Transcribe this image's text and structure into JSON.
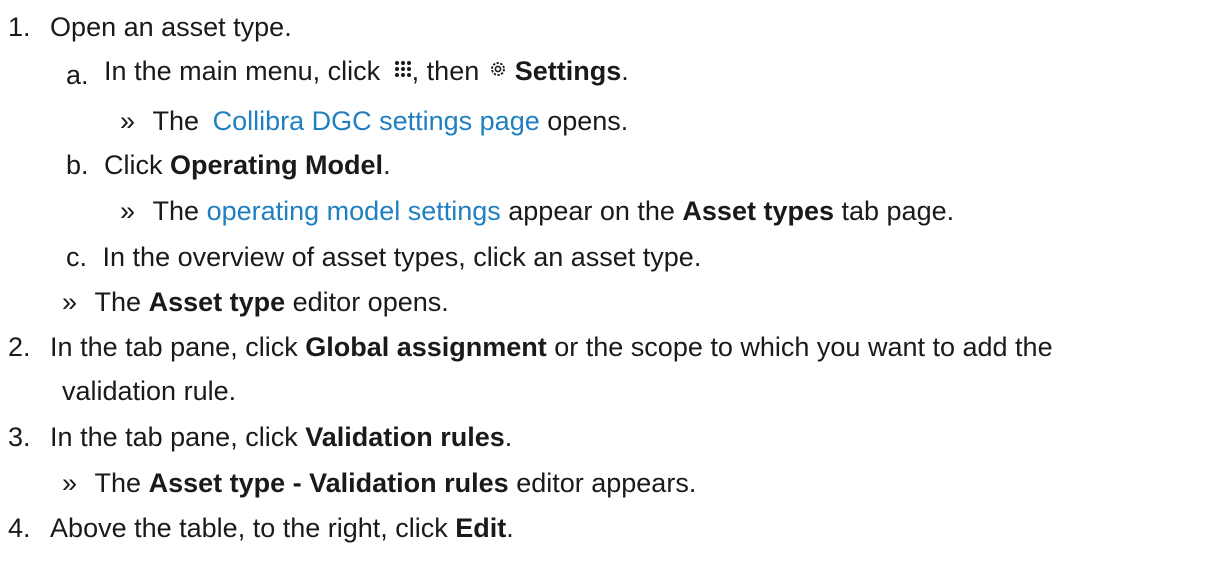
{
  "steps": [
    {
      "number": "1.",
      "text": "Open an asset type.",
      "substeps": [
        {
          "letter": "a.",
          "t1": "In the main menu, click ",
          "t2": ", then ",
          "settings_label": "Settings",
          "t3": ".",
          "result": {
            "arrow": "»",
            "t1": "The ",
            "link": "Collibra DGC settings page",
            "t2": " opens."
          }
        },
        {
          "letter": "b.",
          "t1": "Click ",
          "bold": "Operating Model",
          "t2": ".",
          "result": {
            "arrow": "»",
            "t1": "The ",
            "link": "operating model settings",
            "t2": " appear on the ",
            "bold": "Asset types",
            "t3": " tab page."
          }
        },
        {
          "letter": "c.",
          "text": "In the overview of asset types, click an asset type."
        }
      ],
      "result": {
        "arrow": "»",
        "t1": "The ",
        "bold": "Asset type",
        "t2": " editor opens."
      }
    },
    {
      "number": "2.",
      "t1": "In the tab pane, click ",
      "bold": "Global assignment",
      "t2": " or the scope to which you want to add the",
      "line2": "validation rule."
    },
    {
      "number": "3.",
      "t1": "In the tab pane, click ",
      "bold": "Validation rules",
      "t2": ".",
      "result": {
        "arrow": "»",
        "t1": "The ",
        "bold": "Asset type - Validation rules",
        "t2": " editor appears."
      }
    },
    {
      "number": "4.",
      "t1": "Above the table, to the right, click ",
      "bold": "Edit",
      "t2": "."
    }
  ],
  "icons": {
    "main_menu": "apps-grid-icon",
    "settings": "gear-icon"
  },
  "colors": {
    "text": "#1a1a1a",
    "link": "#1f7fc1"
  }
}
